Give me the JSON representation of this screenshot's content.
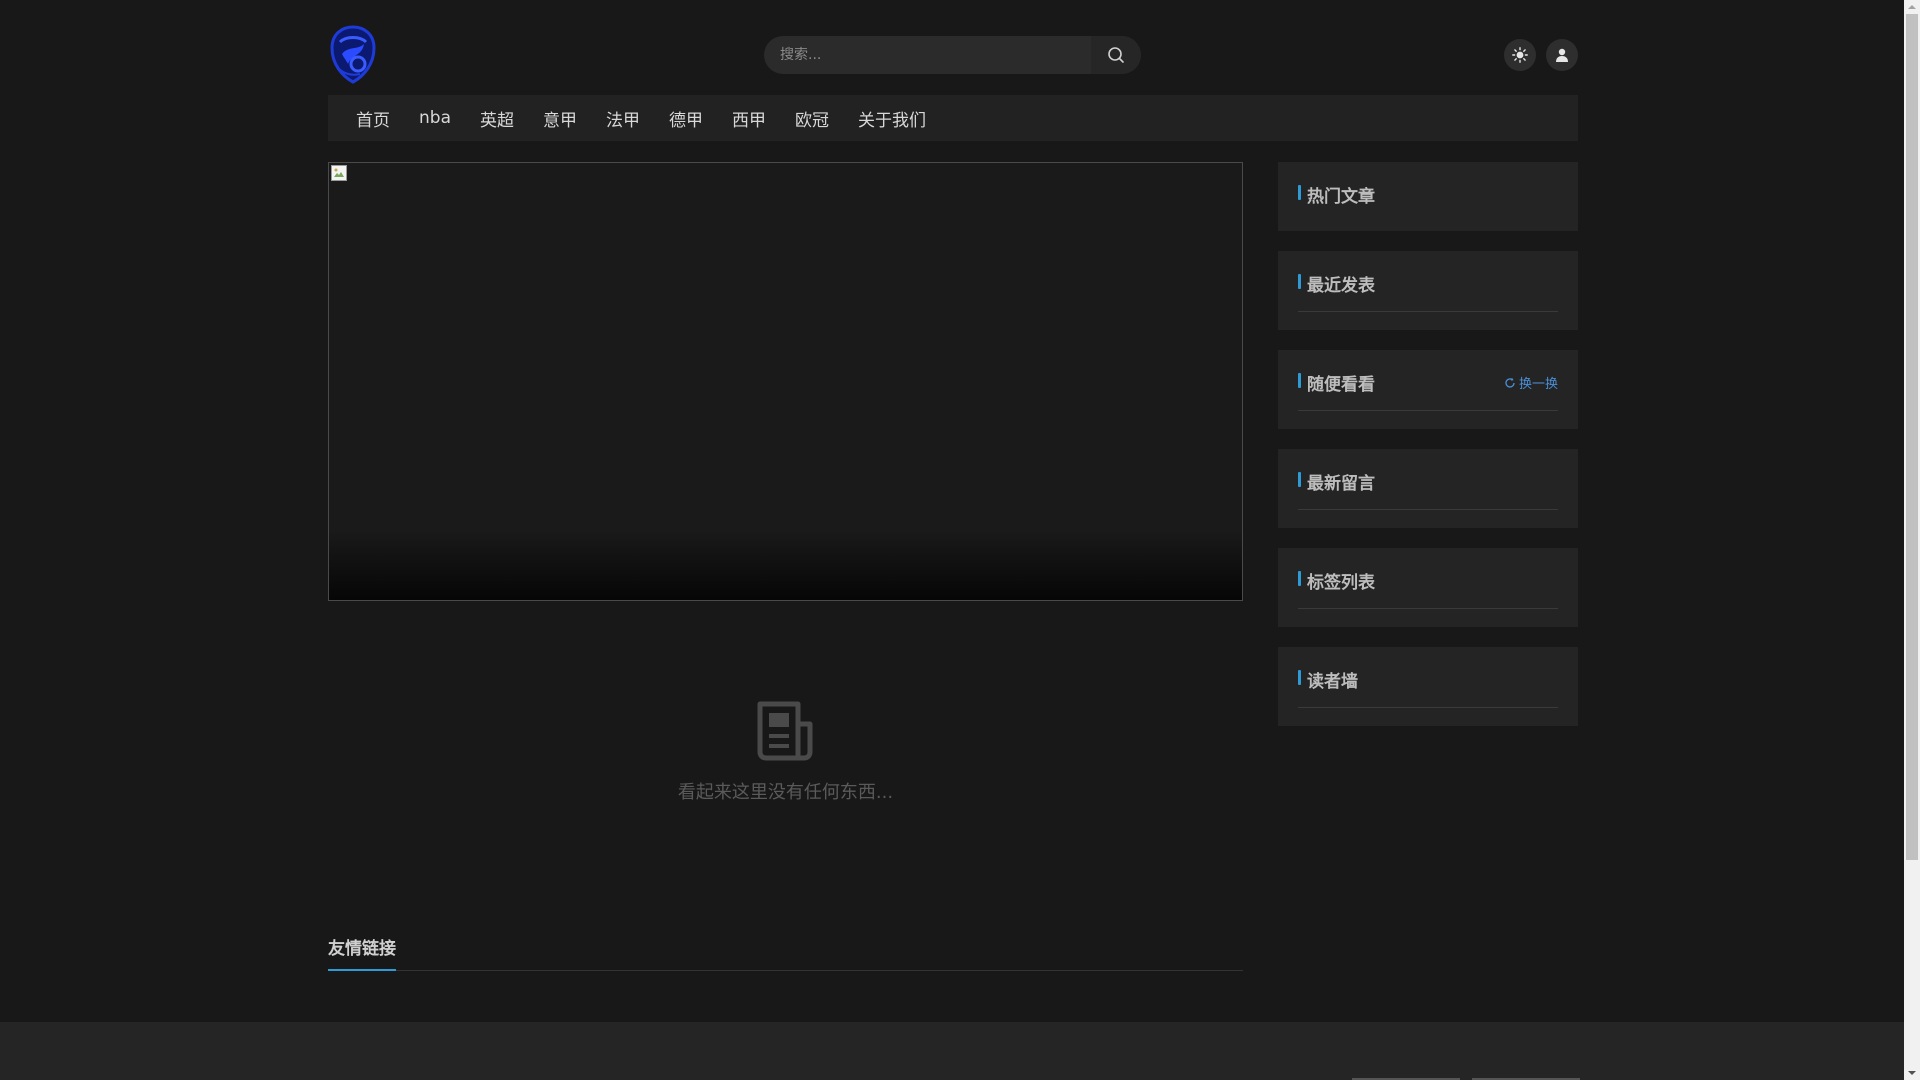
{
  "header": {
    "search": {
      "placeholder": "搜索...",
      "value": ""
    },
    "icons": {
      "logo": "team-crest-logo",
      "search": "search-icon",
      "theme": "sun-icon",
      "user": "user-icon"
    }
  },
  "nav": {
    "items": [
      {
        "label": "首页"
      },
      {
        "label": "nba"
      },
      {
        "label": "英超"
      },
      {
        "label": "意甲"
      },
      {
        "label": "法甲"
      },
      {
        "label": "德甲"
      },
      {
        "label": "西甲"
      },
      {
        "label": "欧冠"
      },
      {
        "label": "关于我们"
      }
    ]
  },
  "main": {
    "empty_text": "看起来这里没有任何东西...",
    "links_title": "友情链接"
  },
  "sidebar": {
    "hot": {
      "title": "热门文章"
    },
    "recent": {
      "title": "最近发表"
    },
    "random": {
      "title": "随便看看",
      "refresh_label": "换一换"
    },
    "comments": {
      "title": "最新留言"
    },
    "tags": {
      "title": "标签列表"
    },
    "readers": {
      "title": "读者墙"
    }
  },
  "colors": {
    "accent": "#2e9bd6",
    "link": "#4a8fd6",
    "background": "#181818",
    "panel": "#242424"
  }
}
